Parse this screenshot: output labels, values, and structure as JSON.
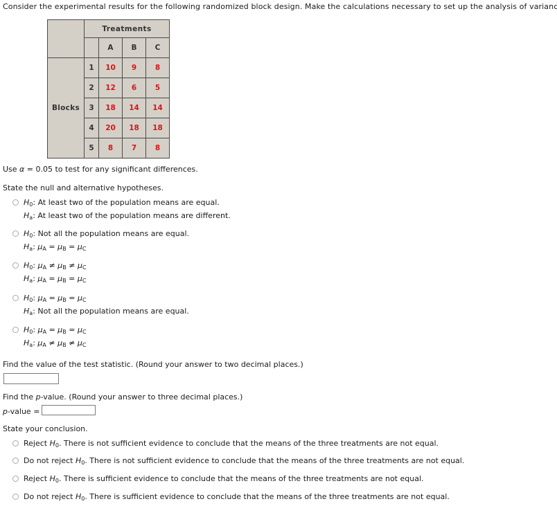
{
  "intro": "Consider the experimental results for the following randomized block design. Make the calculations necessary to set up the analysis of variance table.",
  "table": {
    "group_header": "Treatments",
    "row_group_label": "Blocks",
    "columns": [
      "A",
      "B",
      "C"
    ],
    "block_labels": [
      "1",
      "2",
      "3",
      "4",
      "5"
    ],
    "rows": [
      [
        10,
        9,
        8
      ],
      [
        12,
        6,
        5
      ],
      [
        18,
        14,
        14
      ],
      [
        20,
        18,
        18
      ],
      [
        8,
        7,
        8
      ]
    ],
    "header_bg": "#d4d0c8",
    "data_color": "#d41818",
    "border_color": "#4a4a46"
  },
  "alpha_line": {
    "prefix": "Use ",
    "alpha": "α",
    "suffix": " = 0.05 to test for any significant differences."
  },
  "hypotheses": {
    "prompt": "State the null and alternative hypotheses.",
    "options": [
      {
        "null_label": "H",
        "null_sub": "0",
        "null_text": ": At least two of the population means are equal.",
        "alt_label": "H",
        "alt_sub": "a",
        "alt_text": ": At least two of the population means are different.",
        "type": "text"
      },
      {
        "null_label": "H",
        "null_sub": "0",
        "null_text": ": Not all the population means are equal.",
        "alt_label": "H",
        "alt_sub": "a",
        "alt_text": ": μA = μB = μC",
        "type": "mu_eq_eq"
      },
      {
        "null_label": "H",
        "null_sub": "0",
        "null_text": ": μA ≠ μB ≠ μC",
        "alt_label": "H",
        "alt_sub": "a",
        "alt_text": ": μA = μB = μC",
        "type": "mu_ne_then_eq"
      },
      {
        "null_label": "H",
        "null_sub": "0",
        "null_text": ": μA = μB = μC",
        "alt_label": "H",
        "alt_sub": "a",
        "alt_text": ": Not all the population means are equal.",
        "type": "mu_eq_then_text"
      },
      {
        "null_label": "H",
        "null_sub": "0",
        "null_text": ": μA = μB = μC",
        "alt_label": "H",
        "alt_sub": "a",
        "alt_text": ": μA ≠ μB ≠ μC",
        "type": "mu_eq_then_ne"
      }
    ],
    "mu": "μ",
    "eq": "=",
    "neq": "≠",
    "subs": [
      "A",
      "B",
      "C"
    ]
  },
  "test_statistic": {
    "prompt": "Find the value of the test statistic. (Round your answer to two decimal places.)",
    "value": "",
    "placeholder": ""
  },
  "p_value": {
    "prompt_prefix": "Find the ",
    "prompt_italic": "p",
    "prompt_suffix": "-value. (Round your answer to three decimal places.)",
    "label_italic": "p",
    "label_rest": "-value = ",
    "value": "",
    "placeholder": ""
  },
  "conclusion": {
    "prompt": "State your conclusion.",
    "options": [
      {
        "lead": "Reject ",
        "h_label": "H",
        "h_sub": "0",
        "rest": ". There is not sufficient evidence to conclude that the means of the three treatments are not equal."
      },
      {
        "lead": "Do not reject ",
        "h_label": "H",
        "h_sub": "0",
        "rest": ". There is not sufficient evidence to conclude that the means of the three treatments are not equal."
      },
      {
        "lead": "Reject ",
        "h_label": "H",
        "h_sub": "0",
        "rest": ". There is sufficient evidence to conclude that the means of the three treatments are not equal."
      },
      {
        "lead": "Do not reject ",
        "h_label": "H",
        "h_sub": "0",
        "rest": ". There is sufficient evidence to conclude that the means of the three treatments are not equal."
      }
    ]
  }
}
